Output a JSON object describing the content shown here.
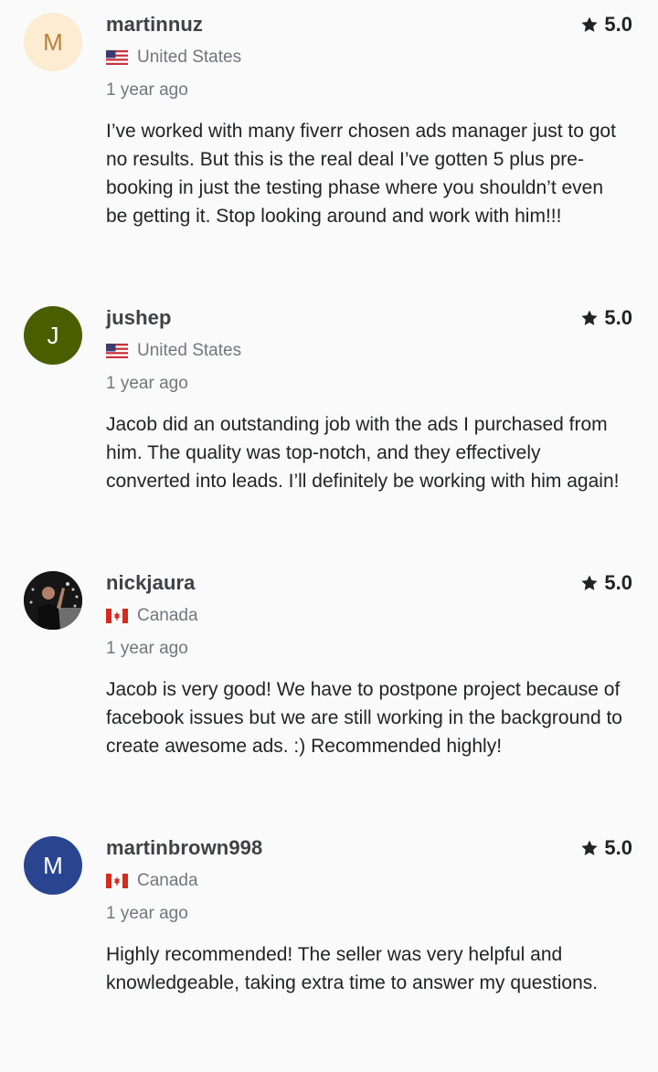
{
  "colors": {
    "background": "#fafafa",
    "star": "#222325",
    "meta_text": "#74767e"
  },
  "reviews": [
    {
      "username": "martinnuz",
      "avatar_letter": "M",
      "avatar_bg": "#fdebd2",
      "avatar_fg": "#b8823a",
      "country": "United States",
      "flag": "us-flag-icon",
      "rating": "5.0",
      "time": "1 year ago",
      "text": "I’ve worked with many fiverr chosen ads manager just to got no results. But this is the real deal I’ve gotten 5 plus pre-booking in just the testing phase where you shouldn’t even be getting it. Stop looking around and work with him!!!"
    },
    {
      "username": "jushep",
      "avatar_letter": "J",
      "avatar_bg": "#4a5e00",
      "avatar_fg": "#ffffff",
      "country": "United States",
      "flag": "us-flag-icon",
      "rating": "5.0",
      "time": "1 year ago",
      "text": "Jacob did an outstanding job with the ads I purchased from him. The quality was top-notch, and they effectively converted into leads. I’ll definitely be working with him again!"
    },
    {
      "username": "nickjaura",
      "avatar_letter": "",
      "avatar_bg": "#1b1b1b",
      "avatar_fg": "#ffffff",
      "country": "Canada",
      "flag": "ca-flag-icon",
      "rating": "5.0",
      "time": "1 year ago",
      "text": "Jacob is very good! We have to postpone project because of facebook issues but we are still working in the background to create awesome ads. :) Recommended highly!"
    },
    {
      "username": "martinbrown998",
      "avatar_letter": "M",
      "avatar_bg": "#2a4590",
      "avatar_fg": "#ffffff",
      "country": "Canada",
      "flag": "ca-flag-icon",
      "rating": "5.0",
      "time": "1 year ago",
      "text": "Highly recommended! The seller was very helpful and knowledgeable, taking extra time to answer my questions."
    }
  ]
}
